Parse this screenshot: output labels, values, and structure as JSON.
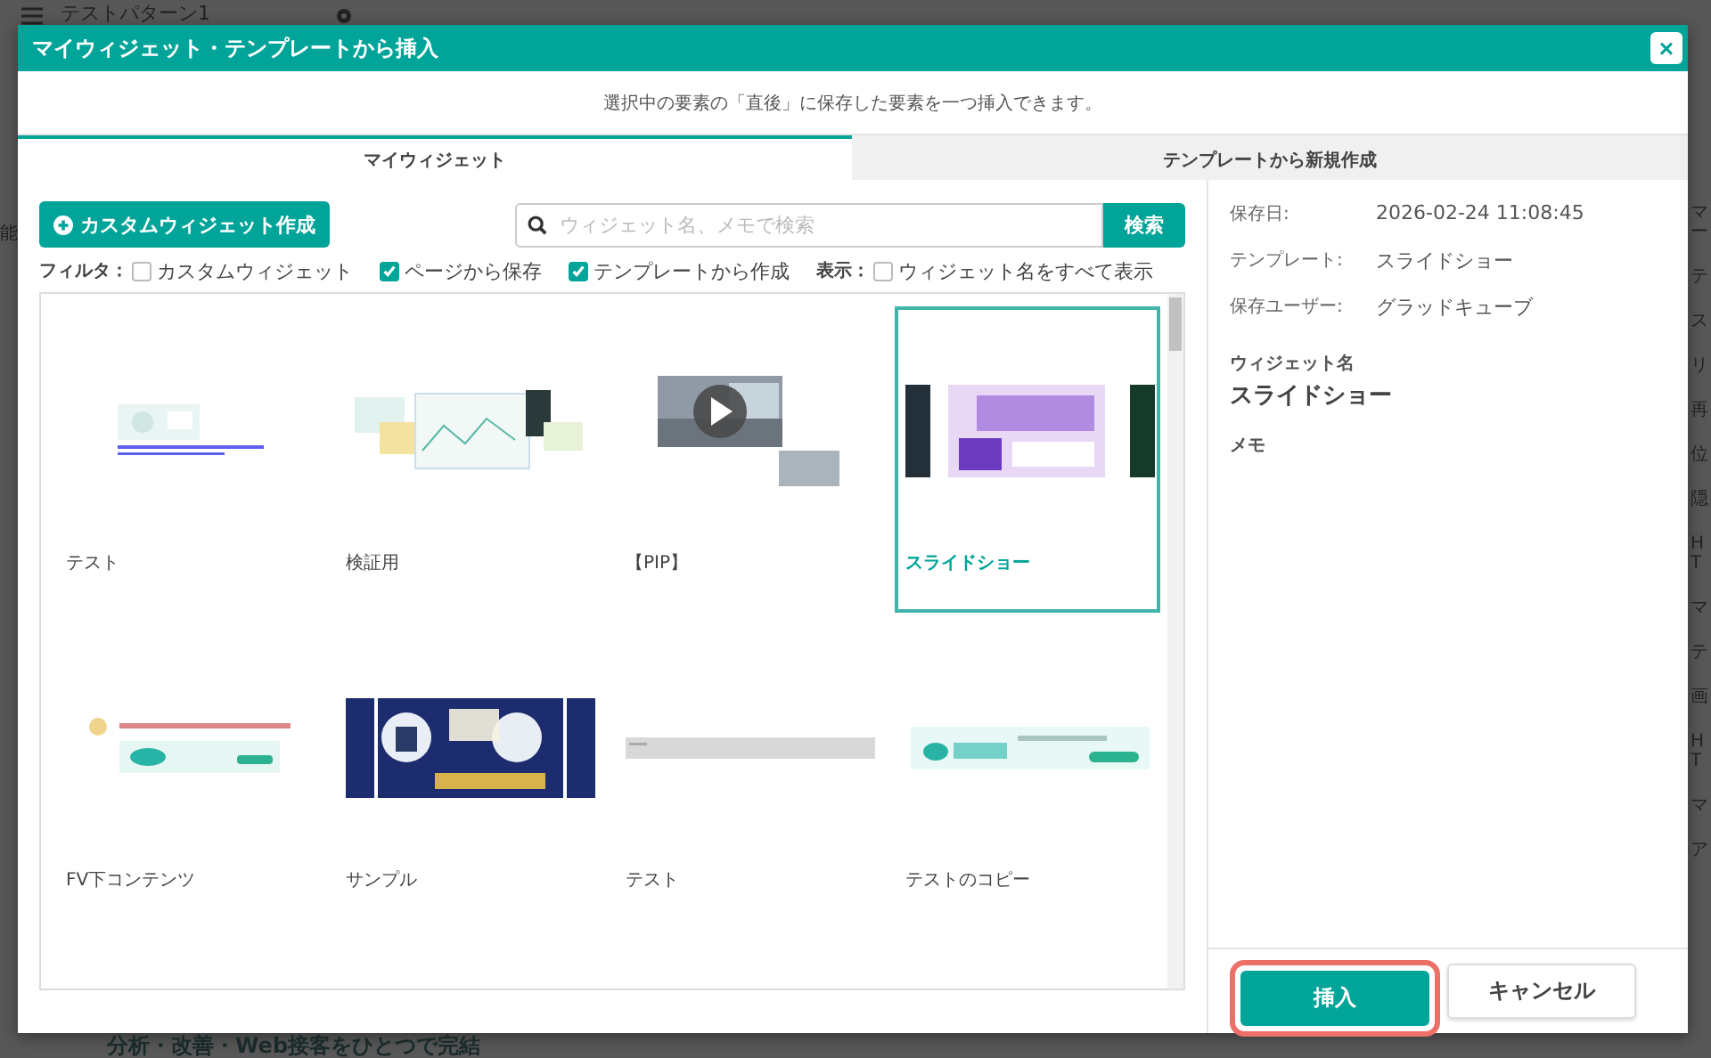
{
  "background": {
    "page_title": "テストパターン1",
    "left_fragments": [
      "能"
    ],
    "right_fragments": [
      "マー",
      "テ",
      "ス",
      "リ",
      "再",
      "位",
      "隠",
      "HT",
      "マ",
      "テ",
      "画",
      "HT",
      "マ",
      "ア"
    ],
    "headline": "分析・改善・Web接客をひとつで完結"
  },
  "dialog": {
    "title": "マイウィジェット・テンプレートから挿入",
    "close": "×",
    "description": "選択中の要素の「直後」に保存した要素を一つ挿入できます。",
    "tabs": [
      {
        "label": "マイウィジェット",
        "selected": true
      },
      {
        "label": "テンプレートから新規作成",
        "selected": false
      }
    ],
    "create_button": "カスタムウィジェット作成",
    "search": {
      "placeholder": "ウィジェット名、メモで検索",
      "button": "検索"
    },
    "filter": {
      "label": "フィルタ：",
      "options": [
        {
          "label": "カスタムウィジェット",
          "checked": false
        },
        {
          "label": "ページから保存",
          "checked": true
        },
        {
          "label": "テンプレートから作成",
          "checked": true
        }
      ]
    },
    "display": {
      "label": "表示：",
      "option": {
        "label": "ウィジェット名をすべて表示",
        "checked": false
      }
    },
    "widgets": [
      {
        "name": "テスト",
        "selected": false
      },
      {
        "name": "検証用",
        "selected": false
      },
      {
        "name": "【PIP】",
        "selected": false
      },
      {
        "name": "スライドショー",
        "selected": true
      },
      {
        "name": "FV下コンテンツ",
        "selected": false
      },
      {
        "name": "サンプル",
        "selected": false
      },
      {
        "name": "テスト",
        "selected": false
      },
      {
        "name": "テストのコピー",
        "selected": false
      }
    ],
    "details": {
      "rows": [
        {
          "label": "保存日:",
          "value": "2026-02-24 11:08:45"
        },
        {
          "label": "テンプレート:",
          "value": "スライドショー"
        },
        {
          "label": "保存ユーザー:",
          "value": "グラッドキューブ"
        }
      ],
      "name_label": "ウィジェット名",
      "name_value": "スライドショー",
      "memo_label": "メモ"
    },
    "buttons": {
      "insert": "挿入",
      "cancel": "キャンセル"
    }
  }
}
